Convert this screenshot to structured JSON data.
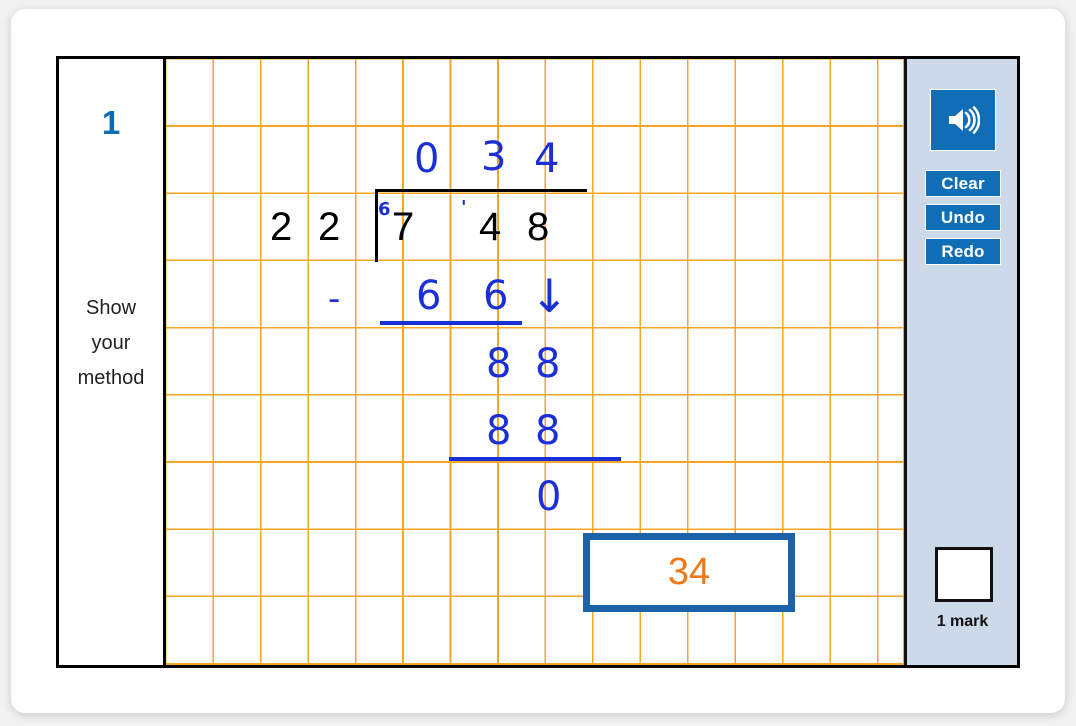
{
  "question": {
    "number": "1",
    "instruction_label": "Show\nyour\nmethod"
  },
  "worksheet": {
    "divisor": [
      "2",
      "2"
    ],
    "dividend": [
      "7",
      "4",
      "8"
    ],
    "quotient": [
      "0",
      "3",
      "4"
    ],
    "carry_marks": [
      "6",
      "'"
    ],
    "subtraction_row": {
      "operator": "-",
      "digits": [
        "6",
        "6"
      ],
      "bring_down": "↓"
    },
    "remainder_row": [
      "8",
      "8"
    ],
    "second_subtraction": [
      "8",
      "8"
    ],
    "final_remainder": "0"
  },
  "answer_box": {
    "value": "34"
  },
  "toolbar": {
    "sound_icon": "speaker-icon",
    "clear_label": "Clear",
    "undo_label": "Undo",
    "redo_label": "Redo",
    "mark_label": "1 mark"
  },
  "colors": {
    "accent_blue": "#0f6eb5",
    "handwriting_blue": "#1a2fd6",
    "answer_orange": "#f07818",
    "grid_orange": "#f5a623",
    "sidebar_bg": "#ccd9e8"
  }
}
